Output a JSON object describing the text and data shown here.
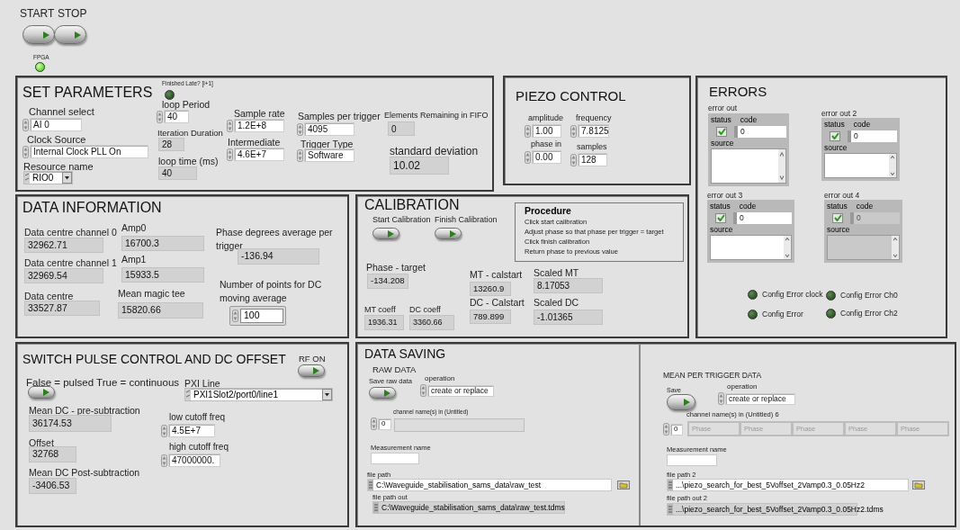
{
  "run_buttons": [
    {
      "label": "START"
    },
    {
      "label": "STOP"
    }
  ],
  "fpga": {
    "label": "FPGA",
    "on": true
  },
  "set_parameters": {
    "title": "SET PARAMETERS",
    "channel_select": {
      "label": "Channel select",
      "value": "AI 0"
    },
    "clock_source": {
      "label": "Clock Source",
      "value": "Internal Clock PLL On"
    },
    "resource_name": {
      "label": "Resource name",
      "value": "RIO0"
    },
    "finished_late": {
      "label": "Finished Late? [i+1]",
      "on": false
    },
    "loop_period": {
      "label": "loop Period",
      "value": "40"
    },
    "iteration_duration": {
      "label": "Iteration Duration",
      "value": "28"
    },
    "loop_time": {
      "label": "loop time (ms)",
      "value": "40"
    },
    "sample_rate": {
      "label": "Sample rate",
      "value": "1.2E+8"
    },
    "intermediate": {
      "label": "Intermediate",
      "value": "4.6E+7"
    },
    "samples_per_trigger": {
      "label": "Samples per trigger",
      "value": "4095"
    },
    "trigger_type": {
      "label": "Trigger Type",
      "value": "Software"
    },
    "elements_remaining": {
      "label": "Elements Remaining in FIFO",
      "value": "0"
    },
    "standard_deviation": {
      "label": "standard deviation",
      "value": "10.02"
    }
  },
  "piezo_control": {
    "title": "PIEZO CONTROL",
    "amplitude": {
      "label": "amplitude",
      "value": "1.00"
    },
    "frequency": {
      "label": "frequency",
      "value": "7.8125"
    },
    "phase_in": {
      "label": "phase in",
      "value": "0.00"
    },
    "samples": {
      "label": "samples",
      "value": "128"
    }
  },
  "errors": {
    "title": "ERRORS",
    "clusters": [
      {
        "label": "error out",
        "status_label": "status",
        "code_label": "code",
        "status": true,
        "code": "0",
        "source_label": "source",
        "disabled": false
      },
      {
        "label": "error out 2",
        "status_label": "status",
        "code_label": "code",
        "status": true,
        "code": "0",
        "source_label": "source",
        "disabled": false
      },
      {
        "label": "error out 3",
        "status_label": "status",
        "code_label": "code",
        "status": true,
        "code": "0",
        "source_label": "source",
        "disabled": false
      },
      {
        "label": "error out 4",
        "status_label": "status",
        "code_label": "code",
        "status": true,
        "code": "0",
        "source_label": "source",
        "disabled": true
      }
    ],
    "leds": [
      {
        "label": "Config Error clock",
        "on": false
      },
      {
        "label": "Config Error Ch0",
        "on": false
      },
      {
        "label": "Config Error",
        "on": false
      },
      {
        "label": "Config Error Ch2",
        "on": false
      }
    ]
  },
  "data_information": {
    "title": "DATA INFORMATION",
    "data_centre_channel_0": {
      "label": "Data centre channel 0",
      "value": "32962.71"
    },
    "amp0": {
      "label": "Amp0",
      "value": "16700.3"
    },
    "phase_average": {
      "label": "Phase degrees average per trigger",
      "value": "-136.94"
    },
    "data_centre_channel_1": {
      "label": "Data centre channel 1",
      "value": "32969.54"
    },
    "amp1": {
      "label": "Amp1",
      "value": "15933.5"
    },
    "data_centre": {
      "label": "Data centre",
      "value": "33527.87"
    },
    "mean_magic_tee": {
      "label": "Mean magic tee",
      "value": "15820.66"
    },
    "dc_points": {
      "label": "Number of points for DC moving average",
      "value": "100"
    }
  },
  "calibration": {
    "title": "CALIBRATION",
    "start_calibration": {
      "label": "Start Calibration"
    },
    "finish_calibration": {
      "label": "Finish Calibration"
    },
    "procedure": {
      "title": "Procedure",
      "steps": [
        "Click start calibration",
        "Adjust phase so that phase per trigger = target",
        "Click finish calibration",
        "Return phase to previous value"
      ]
    },
    "phase_target": {
      "label": "Phase - target",
      "value": "-134.208"
    },
    "mt_calstart": {
      "label": "MT - calstart",
      "value": "13260.9"
    },
    "scaled_mt": {
      "label": "Scaled MT",
      "value": "8.17053"
    },
    "mt_coeff": {
      "label": "MT coeff",
      "value": "1936.31"
    },
    "dc_coeff": {
      "label": "DC coeff",
      "value": "3360.66"
    },
    "dc_calstart": {
      "label": "DC - Calstart",
      "value": "789.899"
    },
    "scaled_dc": {
      "label": "Scaled DC",
      "value": "-1.01365"
    }
  },
  "switch_pulse": {
    "title": "SWITCH PULSE CONTROL AND DC OFFSET",
    "rf_on": {
      "label": "RF ON"
    },
    "pulse_mode": {
      "label": "False = pulsed True = continuous"
    },
    "pxi_line": {
      "label": "PXI Line",
      "value": "PXI1Slot2/port0/line1"
    },
    "mean_dc_pre": {
      "label": "Mean DC - pre-subtraction",
      "value": "36174.53"
    },
    "low_cutoff": {
      "label": "low cutoff freq",
      "value": "4.5E+7"
    },
    "offset": {
      "label": "Offset",
      "value": "32768"
    },
    "high_cutoff": {
      "label": "high cutoff freq",
      "value": "47000000."
    },
    "mean_dc_post": {
      "label": "Mean DC Post-subtraction",
      "value": "-3406.53"
    }
  },
  "data_saving": {
    "title": "DATA SAVING",
    "raw": {
      "title": "RAW DATA",
      "save": {
        "label": "Save raw data"
      },
      "operation": {
        "label": "operation",
        "value": "create or replace"
      },
      "channel_names": {
        "label": "channel name(s) in (Untitled)",
        "index": "0"
      },
      "measurement_name": {
        "label": "Measurement name"
      },
      "file_path": {
        "label": "file path",
        "value": "C:\\Waveguide_stabilisation_sams_data\\raw_test"
      },
      "file_path_out": {
        "label": "file path out",
        "value": "C:\\Waveguide_stabilisation_sams_data\\raw_test.tdms"
      }
    },
    "mean": {
      "title": "MEAN PER TRIGGER DATA",
      "save": {
        "label": "Save"
      },
      "operation": {
        "label": "operation",
        "value": "create or replace"
      },
      "channel_names": {
        "label": "channel name(s) in (Untitled) 6",
        "index": "0",
        "values": [
          "Phase",
          "Phase",
          "Phase",
          "Phase",
          "Phase"
        ]
      },
      "measurement_name": {
        "label": "Measurement name"
      },
      "file_path": {
        "label": "file path 2",
        "value": "...\\piezo_search_for_best_5Voffset_2Vamp0.3_0.05Hz2"
      },
      "file_path_out": {
        "label": "file path out 2",
        "value": "...\\piezo_search_for_best_5Voffset_2Vamp0.3_0.05Hz2.tdms"
      }
    }
  }
}
